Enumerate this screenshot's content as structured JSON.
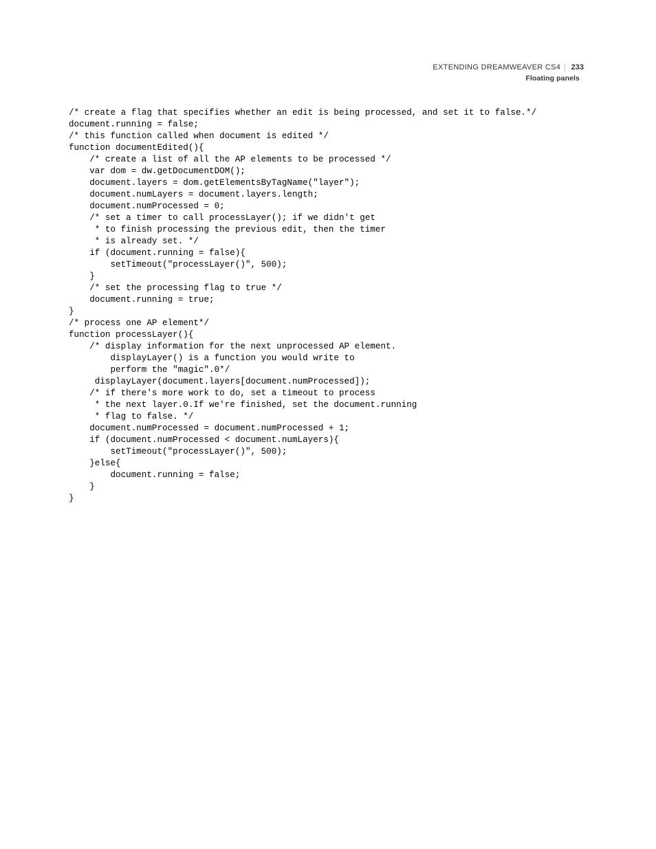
{
  "header": {
    "title": "EXTENDING DREAMWEAVER CS4",
    "page_number": "233",
    "section": "Floating panels"
  },
  "code_lines": [
    "/* create a flag that specifies whether an edit is being processed, and set it to false.*/",
    "document.running = false;",
    "/* this function called when document is edited */",
    "function documentEdited(){",
    "    /* create a list of all the AP elements to be processed */",
    "    var dom = dw.getDocumentDOM();",
    "    document.layers = dom.getElementsByTagName(\"layer\");",
    "    document.numLayers = document.layers.length;",
    "    document.numProcessed = 0;",
    "    /* set a timer to call processLayer(); if we didn't get",
    "     * to finish processing the previous edit, then the timer",
    "     * is already set. */",
    "    if (document.running = false){",
    "        setTimeout(\"processLayer()\", 500);",
    "    }",
    "    /* set the processing flag to true */",
    "    document.running = true;",
    "}",
    "/* process one AP element*/",
    "function processLayer(){",
    "    /* display information for the next unprocessed AP element.",
    "        displayLayer() is a function you would write to",
    "        perform the \"magic\".0*/",
    "     displayLayer(document.layers[document.numProcessed]);",
    "    /* if there's more work to do, set a timeout to process",
    "     * the next layer.0.If we're finished, set the document.running",
    "     * flag to false. */",
    "    document.numProcessed = document.numProcessed + 1;",
    "    if (document.numProcessed < document.numLayers){",
    "        setTimeout(\"processLayer()\", 500);",
    "    }else{",
    "        document.running = false;",
    "    }",
    "}"
  ]
}
